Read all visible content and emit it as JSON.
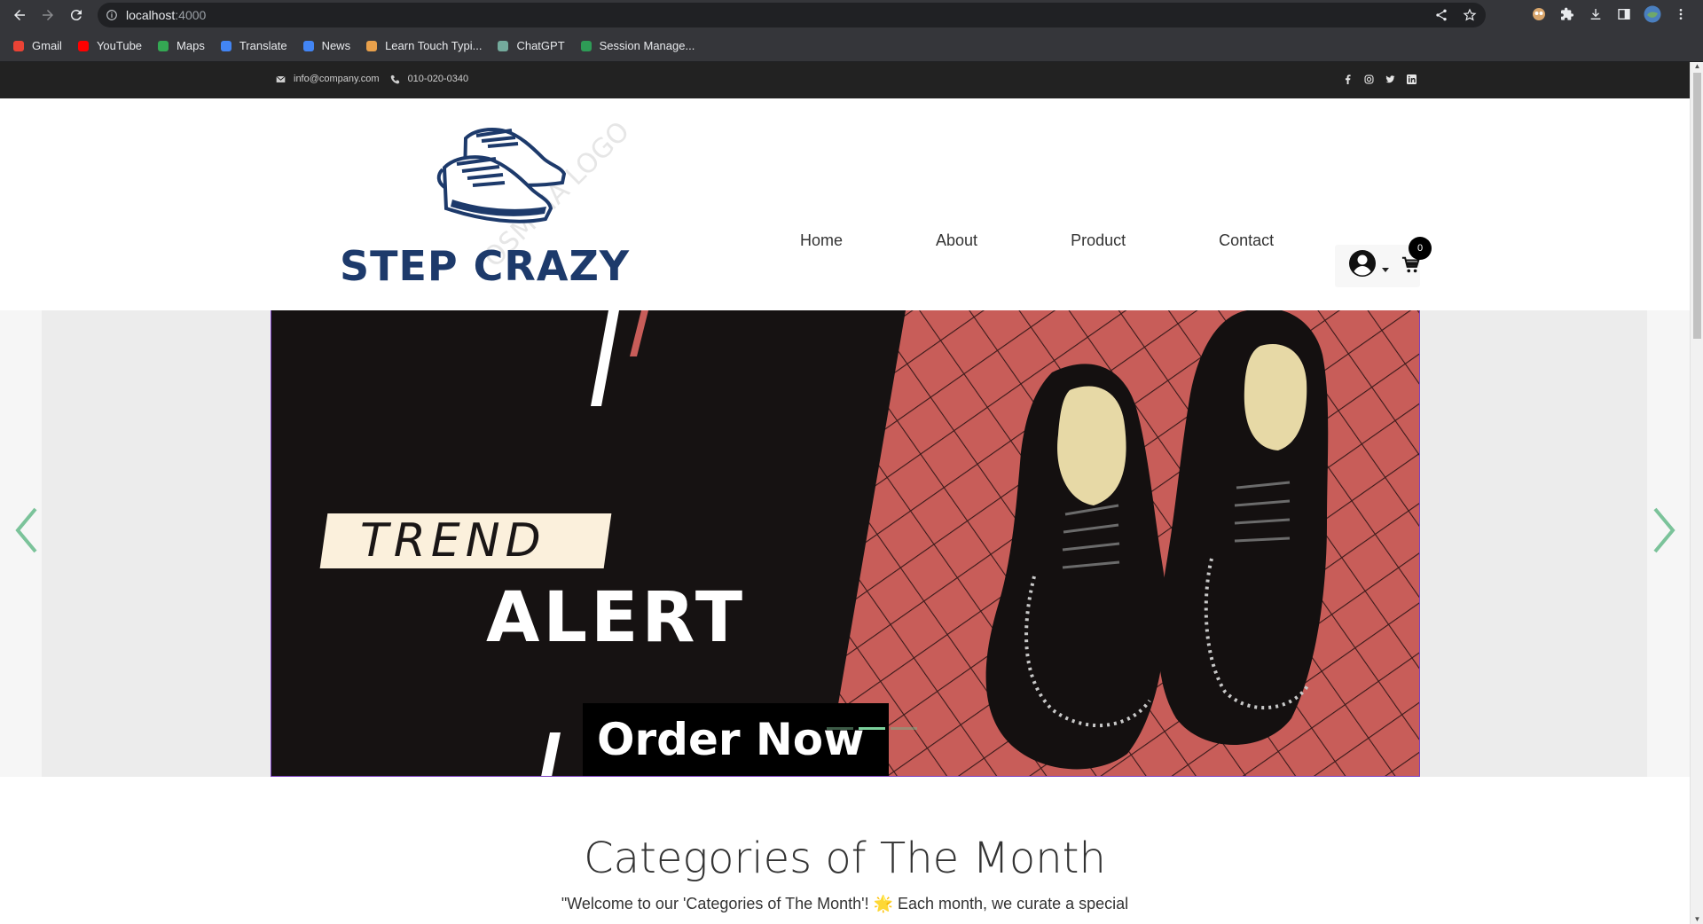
{
  "browser": {
    "url_host": "localhost",
    "url_port": ":4000",
    "bookmarks": [
      {
        "label": "Gmail",
        "icon": "gmail-icon",
        "color": "#ea4335"
      },
      {
        "label": "YouTube",
        "icon": "youtube-icon",
        "color": "#ff0000"
      },
      {
        "label": "Maps",
        "icon": "maps-icon",
        "color": "#34a853"
      },
      {
        "label": "Translate",
        "icon": "translate-icon",
        "color": "#4285f4"
      },
      {
        "label": "News",
        "icon": "news-icon",
        "color": "#4285f4"
      },
      {
        "label": "Learn Touch Typi...",
        "icon": "typing-icon",
        "color": "#e8a04b"
      },
      {
        "label": "ChatGPT",
        "icon": "chatgpt-icon",
        "color": "#74aa9c"
      },
      {
        "label": "Session Manage...",
        "icon": "session-icon",
        "color": "#2e9b56"
      }
    ]
  },
  "topbar": {
    "email": "info@company.com",
    "phone": "010-020-0340",
    "social": [
      "facebook-icon",
      "instagram-icon",
      "twitter-icon",
      "linkedin-icon"
    ]
  },
  "header": {
    "logo_text": "STEP CRAZY",
    "nav": [
      "Home",
      "About",
      "Product",
      "Contact"
    ],
    "cart_count": "0"
  },
  "carousel": {
    "trend": "TREND",
    "alert": "ALERT",
    "order": "Order Now",
    "indicator_count": 3,
    "active_index": 1
  },
  "categories": {
    "title": "Categories of The Month",
    "description": "\"Welcome to our 'Categories of The Month'! 🌟 Each month, we curate a special"
  },
  "colors": {
    "brand": "#1d3a6b",
    "topbar_bg": "#222222",
    "slide_red": "#c95a55",
    "arrow": "#7bc39a"
  }
}
